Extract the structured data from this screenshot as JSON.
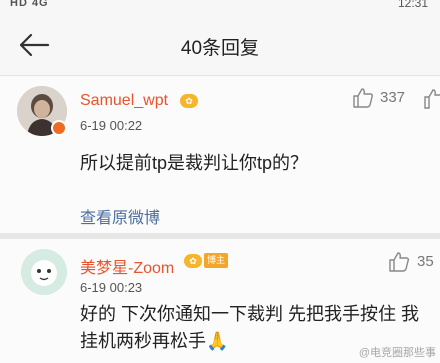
{
  "status_bar": {
    "left": "HD 4G",
    "time": "12:31"
  },
  "header": {
    "title": "40条回复"
  },
  "comments": [
    {
      "username": "Samuel_wpt",
      "time": "6-19 00:22",
      "likes": "337",
      "text": "所以提前tp是裁判让你tp的？",
      "link": "查看原微博"
    },
    {
      "username": "美梦星-Zoom",
      "badge": "博主",
      "time": "6-19 00:23",
      "likes": "35",
      "text": "好的 下次你通知一下裁判 先把我手按住 我挂机两秒再松手🙏"
    }
  ],
  "watermark": "@电竞圈那些事",
  "colors": {
    "username": "#e8542d",
    "link": "#4b6fa0",
    "badge": "#f3a62a",
    "verify": "#f06a23"
  }
}
